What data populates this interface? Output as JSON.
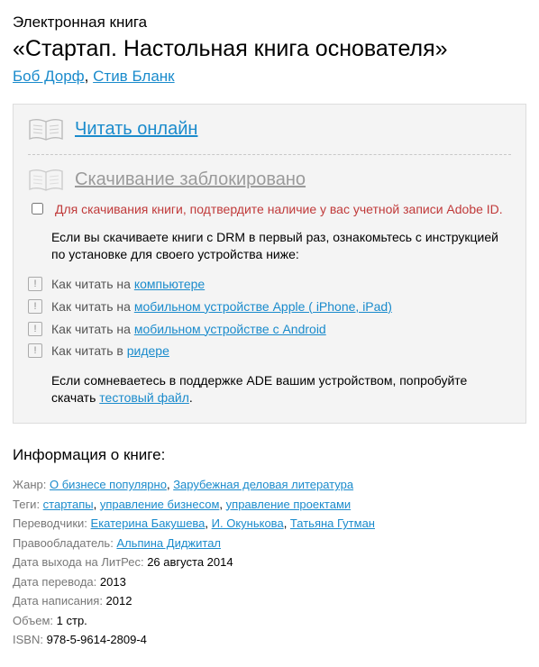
{
  "header": {
    "ebook_label": "Электронная книга",
    "title": "«Стартап. Настольная книга основателя»",
    "authors": [
      "Боб Дорф",
      "Стив Бланк"
    ],
    "authors_sep": ", "
  },
  "panel": {
    "read_online": "Читать онлайн",
    "download_blocked": "Скачивание заблокировано",
    "adobe_notice": "Для скачивания книги, подтвердите наличие у вас учетной записи Adobe ID.",
    "drm_intro": "Если вы скачиваете книги с DRM в первый раз, ознакомьтесь с инструкцией по установке для своего устройства ниже:",
    "hints": [
      {
        "prefix": "Как читать на ",
        "link": "компьютере"
      },
      {
        "prefix": "Как читать на ",
        "link": "мобильном устройстве Apple ( iPhone, iPad)"
      },
      {
        "prefix": "Как читать на ",
        "link": "мобильном устройстве с Android"
      },
      {
        "prefix": "Как читать в ",
        "link": "ридере"
      }
    ],
    "ade_text_prefix": "Если сомневаетесь в поддержке ADE вашим устройством, попробуйте скачать ",
    "ade_link": "тестовый файл",
    "ade_suffix": "."
  },
  "info": {
    "heading": "Информация о книге:",
    "genre_label": "Жанр: ",
    "genres": [
      "О бизнесе популярно",
      "Зарубежная деловая литература"
    ],
    "tags_label": "Теги: ",
    "tags": [
      "стартапы",
      "управление бизнесом",
      "управление проектами"
    ],
    "translators_label": "Переводчики: ",
    "translators": [
      "Екатерина Бакушева",
      "И. Окунькова",
      "Татьяна Гутман"
    ],
    "rights_label": "Правообладатель: ",
    "rights_holder": "Альпина Диджитал",
    "litres_date_label": "Дата выхода на ЛитРес: ",
    "litres_date": "26 августа 2014",
    "trans_date_label": "Дата перевода: ",
    "trans_date": "2013",
    "write_date_label": "Дата написания: ",
    "write_date": "2012",
    "volume_label": "Объем: ",
    "volume": "1 стр.",
    "isbn_label": "ISBN: ",
    "isbn": "978-5-9614-2809-4",
    "sep": ", "
  }
}
